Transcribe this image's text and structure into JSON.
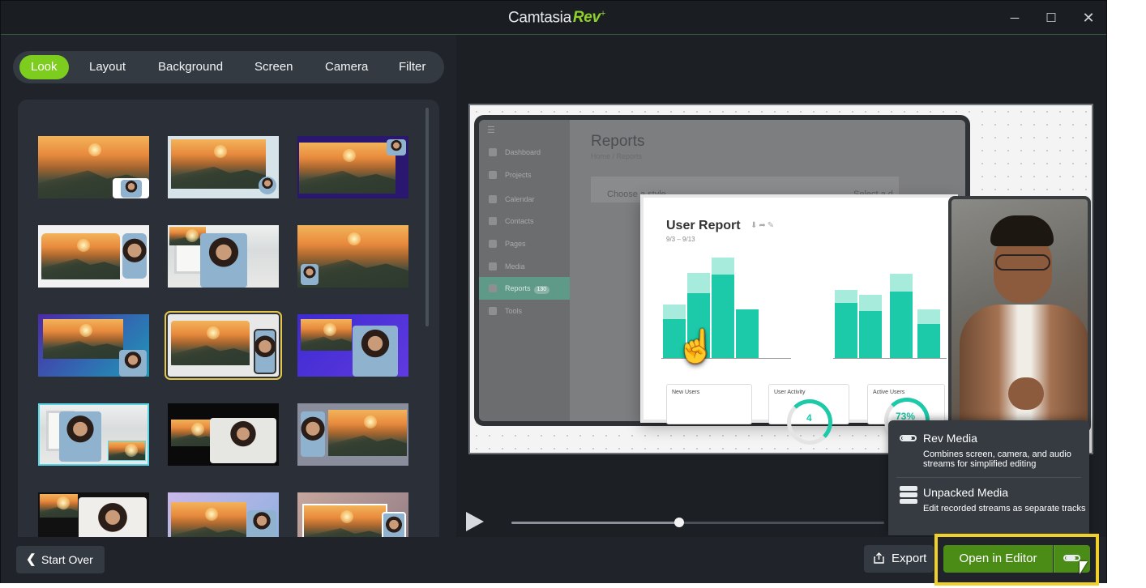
{
  "window": {
    "app_name": "Camtasia",
    "brand_suffix": "Rev",
    "brand_plus": "+",
    "minimize_glyph": "─",
    "maximize_glyph": "☐",
    "close_glyph": "✕"
  },
  "tabs": [
    {
      "label": "Look",
      "active": true
    },
    {
      "label": "Layout",
      "active": false
    },
    {
      "label": "Background",
      "active": false
    },
    {
      "label": "Screen",
      "active": false
    },
    {
      "label": "Camera",
      "active": false
    },
    {
      "label": "Filter",
      "active": false
    }
  ],
  "looks": {
    "selected_index": 7,
    "count_visible": 15
  },
  "preview": {
    "dashboard_nav": [
      {
        "label": "Dashboard"
      },
      {
        "label": "Projects"
      },
      {
        "label": "Calendar"
      },
      {
        "label": "Contacts"
      },
      {
        "label": "Pages"
      },
      {
        "label": "Media"
      },
      {
        "label": "Reports",
        "badge": "130"
      },
      {
        "label": "Tools"
      }
    ],
    "page_title": "Reports",
    "breadcrumb": "Home / Reports",
    "select_style": "Choose a style",
    "select_other": "Select a d",
    "report_title": "User Report",
    "report_dates": "9/3 – 9/13",
    "mini_cards": [
      {
        "label": "New Users"
      },
      {
        "label": "User Activity",
        "value": "4"
      },
      {
        "label": "Active Users",
        "value": "73%"
      }
    ]
  },
  "player": {
    "progress": 0.45
  },
  "export_popup": {
    "options": [
      {
        "title": "Rev Media",
        "description": "Combines screen, camera, and audio streams for simplified editing",
        "icon": "toggle-icon"
      },
      {
        "title": "Unpacked Media",
        "description": "Edit recorded streams as separate tracks",
        "icon": "stacked-tracks-icon"
      }
    ]
  },
  "bottom": {
    "start_over": "Start Over",
    "export": "Export",
    "open_in_editor": "Open in Editor"
  },
  "colors": {
    "accent": "#7dcd1e",
    "editor_button": "#4a8c16",
    "highlight": "#f2d02a",
    "chart_teal": "#1cc9a8"
  }
}
